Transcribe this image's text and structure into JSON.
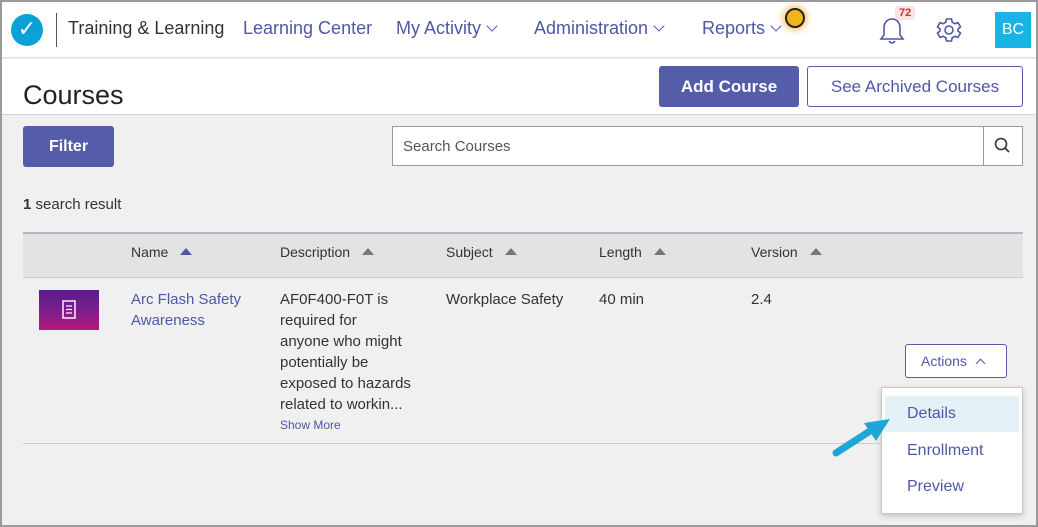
{
  "nav": {
    "app_title": "Training & Learning",
    "links": [
      {
        "label": "Learning Center",
        "has_menu": false
      },
      {
        "label": "My Activity",
        "has_menu": true
      },
      {
        "label": "Administration",
        "has_menu": true
      },
      {
        "label": "Reports",
        "has_menu": true
      }
    ],
    "notification_count": "72",
    "avatar_initials": "BC"
  },
  "header": {
    "title": "Courses",
    "add_button": "Add Course",
    "archived_button": "See Archived Courses"
  },
  "toolbar": {
    "filter_button": "Filter",
    "search_placeholder": "Search Courses"
  },
  "results": {
    "count": "1",
    "label": " search result"
  },
  "table": {
    "columns": [
      "Name",
      "Description",
      "Subject",
      "Length",
      "Version"
    ],
    "rows": [
      {
        "name_line1": "Arc Flash Safety",
        "name_line2": "Awareness",
        "description_lines": [
          "AF0F400-F0T is",
          "required for",
          "anyone who might",
          "potentially be",
          "exposed to hazards",
          "related to workin..."
        ],
        "show_more": "Show More",
        "subject": "Workplace Safety",
        "length": "40 min",
        "version": "2.4"
      }
    ]
  },
  "actions": {
    "button": "Actions",
    "menu": [
      "Details",
      "Enrollment",
      "Preview"
    ]
  },
  "colors": {
    "primary": "#555ca9",
    "link": "#4f57a6",
    "avatar": "#1ab3e6",
    "highlight": "#e4f2f8"
  }
}
